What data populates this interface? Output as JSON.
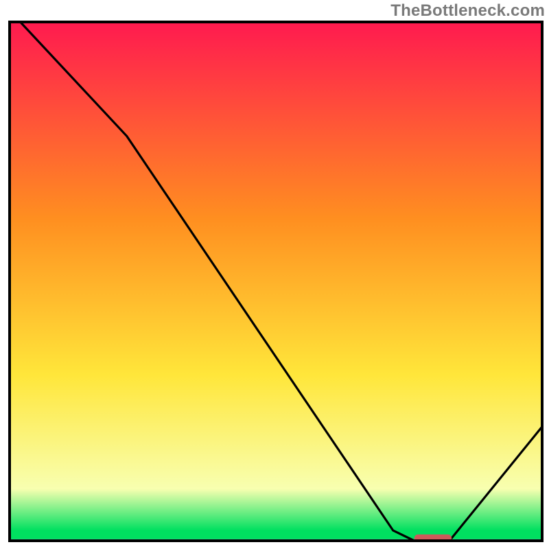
{
  "watermark": {
    "text": "TheBottleneck.com"
  },
  "colors": {
    "top": "#ff1a4f",
    "mid_orange": "#ff8f20",
    "yellow": "#ffe63a",
    "pale": "#f8ffb0",
    "green": "#00e060",
    "axis": "#000000",
    "baseline": "#21d280",
    "line": "#000000",
    "marker": "#cc5a5a"
  },
  "chart_data": {
    "type": "line",
    "title": "",
    "xlabel": "",
    "ylabel": "",
    "xlim": [
      0,
      100
    ],
    "ylim": [
      0,
      100
    ],
    "x": [
      2,
      22,
      72,
      76,
      82,
      83,
      100
    ],
    "values": [
      100,
      78,
      2,
      0,
      0,
      0.5,
      22
    ],
    "marker": {
      "x_start": 76,
      "x_end": 83,
      "y": 0.5
    },
    "gradient_stops": [
      {
        "pct": 0,
        "key": "top"
      },
      {
        "pct": 38,
        "key": "mid_orange"
      },
      {
        "pct": 68,
        "key": "yellow"
      },
      {
        "pct": 90,
        "key": "pale"
      },
      {
        "pct": 98,
        "key": "green"
      },
      {
        "pct": 100,
        "key": "green"
      }
    ]
  }
}
